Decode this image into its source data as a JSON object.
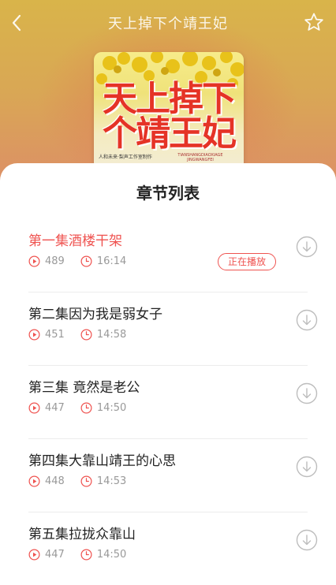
{
  "header": {
    "title": "天上掉下个靖王妃"
  },
  "cover": {
    "title_line1": "天上掉下",
    "title_line2": "个靖王妃",
    "credit": "人和未来·梨声工作室制作",
    "pinyin": "TIANSHANGDIAOXIAGE JINGWANGFEI"
  },
  "sheet": {
    "title": "章节列表"
  },
  "chapters": [
    {
      "name": "第一集酒楼干架",
      "plays": "489",
      "duration": "16:14",
      "active": true
    },
    {
      "name": "第二集因为我是弱女子",
      "plays": "451",
      "duration": "14:58",
      "active": false
    },
    {
      "name": "第三集 竟然是老公",
      "plays": "447",
      "duration": "14:50",
      "active": false
    },
    {
      "name": "第四集大靠山靖王的心思",
      "plays": "448",
      "duration": "14:53",
      "active": false
    },
    {
      "name": "第五集拉拢众靠山",
      "plays": "447",
      "duration": "14:50",
      "active": false
    }
  ],
  "playing_badge": "正在播放",
  "colors": {
    "accent": "#ef5350",
    "meta_text": "#999999"
  }
}
